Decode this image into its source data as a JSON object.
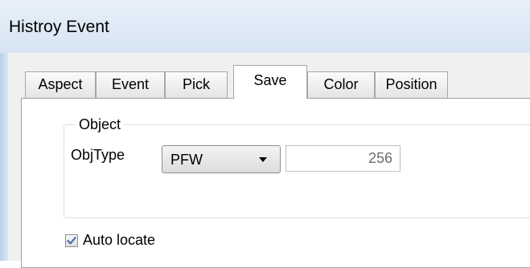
{
  "window": {
    "title": "Histroy Event"
  },
  "tabs": [
    {
      "label": "Aspect"
    },
    {
      "label": "Event"
    },
    {
      "label": "Pick"
    },
    {
      "label": "Save"
    },
    {
      "label": "Color"
    },
    {
      "label": "Position"
    }
  ],
  "active_tab": "Save",
  "object_group": {
    "legend": "Object",
    "objtype_label": "ObjType",
    "objtype_value": "PFW",
    "number_value": "256"
  },
  "auto_locate": {
    "label": "Auto locate",
    "checked": true
  },
  "icons": {
    "combo": "chevron-down-icon",
    "check": "checkmark-icon"
  },
  "colors": {
    "check": "#4b6fb2",
    "titlebar": "#dbe7f4"
  }
}
